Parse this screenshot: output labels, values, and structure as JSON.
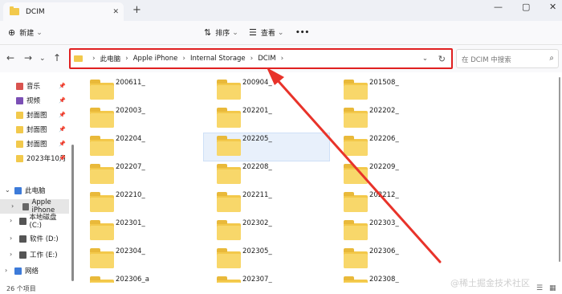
{
  "window": {
    "tab_title": "DCIM",
    "close_tab": "✕",
    "new_tab": "+",
    "minimize": "—",
    "maximize": "▢",
    "close": "✕"
  },
  "ribbon": {
    "new_label": "新建",
    "new_icon": "⊕",
    "sort_label": "排序",
    "sort_icon": "⇅",
    "view_label": "查看",
    "view_icon": "☰",
    "more": "•••",
    "dropdown": "⌄"
  },
  "nav": {
    "back": "←",
    "forward": "→",
    "dropdown": "⌄",
    "up": "↑"
  },
  "address": {
    "crumbs": [
      "此电脑",
      "Apple iPhone",
      "Internal Storage",
      "DCIM"
    ],
    "sep": "›",
    "refresh": "↻",
    "dropdown": "⌄"
  },
  "search": {
    "placeholder": "在 DCIM 中搜索",
    "icon": "⌕"
  },
  "sidebar": {
    "items": [
      {
        "label": "音乐",
        "color": "#d9534f",
        "pinned": true
      },
      {
        "label": "视频",
        "color": "#7b4fb5",
        "pinned": true
      },
      {
        "label": "封面图",
        "color": "#f2c94c",
        "pinned": true
      },
      {
        "label": "封面图",
        "color": "#f2c94c",
        "pinned": true
      },
      {
        "label": "封面图",
        "color": "#f2c94c",
        "pinned": true
      },
      {
        "label": "2023年10月",
        "color": "#f2c94c",
        "pinned": true
      },
      {
        "label": "此电脑",
        "color": "#3d7bd9",
        "pinned": false
      },
      {
        "label": "Apple iPhone",
        "color": "#666666",
        "pinned": false
      },
      {
        "label": "本地磁盘 (C:)",
        "color": "#555555",
        "pinned": false
      },
      {
        "label": "软件 (D:)",
        "color": "#555555",
        "pinned": false
      },
      {
        "label": "工作 (E:)",
        "color": "#555555",
        "pinned": false
      },
      {
        "label": "网络",
        "color": "#3d7bd9",
        "pinned": false
      }
    ],
    "pin_icon": "📌"
  },
  "folders": [
    "200611_",
    "200904_",
    "201508_",
    "202003_",
    "202201_",
    "202202_",
    "202204_",
    "202205_",
    "202206_",
    "202207_",
    "202208_",
    "202209_",
    "202210_",
    "202211_",
    "202212_",
    "202301_",
    "202302_",
    "202303_",
    "202304_",
    "202305_",
    "202306_",
    "202306_a",
    "202307_",
    "202308_"
  ],
  "status": {
    "count": "26 个项目"
  },
  "watermark": "@稀土掘金技术社区",
  "accent": {
    "highlight": "#e02020",
    "folder": "#f3c84a"
  }
}
